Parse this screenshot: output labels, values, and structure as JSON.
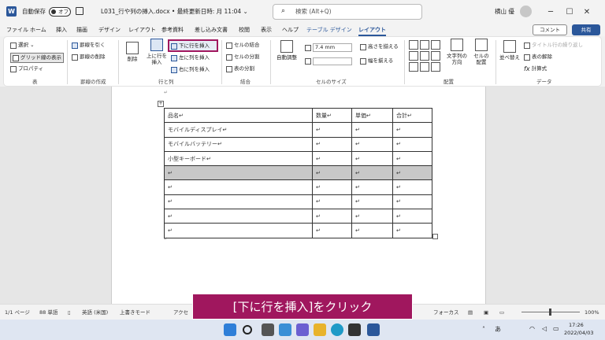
{
  "titlebar": {
    "autosave": "自動保存",
    "toggle": "オフ",
    "doc": "L031_行や列の挿入.docx • 最終更新日時: 月 11:04 ⌄",
    "search": "検索 (Alt+Q)",
    "user": "横山 優",
    "minimize": "─",
    "maximize": "☐",
    "close": "✕"
  },
  "tabs": [
    "ファイル",
    "ホーム",
    "挿入",
    "描画",
    "デザイン",
    "レイアウト",
    "参考資料",
    "差し込み文書",
    "校閲",
    "表示",
    "ヘルプ",
    "テーブル デザイン",
    "レイアウト"
  ],
  "ribbon": {
    "comment": "コメント",
    "share": "共有",
    "select": "選択 ⌄",
    "gridlines": "グリッド線の表示",
    "properties": "プロパティ",
    "group_table": "表",
    "draw": "罫線を引く",
    "erase": "罫線の削除",
    "group_draw": "罫線の作成",
    "delete": "削除",
    "insert_above": "上に行を挿入",
    "insert_below": "下に行を挿入",
    "insert_left": "左に列を挿入",
    "insert_right": "右に列を挿入",
    "group_rows": "行と列",
    "merge": "セルの結合",
    "split": "セルの分割",
    "split_table": "表の分割",
    "group_merge": "結合",
    "autofit": "自動調整",
    "height": "7.4 mm",
    "width": "",
    "dist_rows": "高さを揃える",
    "dist_cols": "幅を揃える",
    "group_size": "セルのサイズ",
    "textdir": "文字列の方向",
    "margins": "セルの配置",
    "group_align": "配置",
    "sort": "並べ替え",
    "header_rows": "タイトル行の繰り返し",
    "convert": "表の解除",
    "formula": "計算式",
    "group_data": "データ"
  },
  "table": {
    "header": [
      "品名↵",
      "数量↵",
      "単価↵",
      "合計↵"
    ],
    "rows": [
      [
        "モバイルディスプレイ↵",
        "↵",
        "↵",
        "↵"
      ],
      [
        "モバイルバッテリー↵",
        "↵",
        "↵",
        "↵"
      ],
      [
        "小型キーボード↵",
        "↵",
        "↵",
        "↵"
      ],
      [
        "↵",
        "↵",
        "↵",
        "↵"
      ],
      [
        "↵",
        "↵",
        "↵",
        "↵"
      ],
      [
        "↵",
        "↵",
        "↵",
        "↵"
      ],
      [
        "↵",
        "↵",
        "↵",
        "↵"
      ],
      [
        "↵",
        "↵",
        "↵",
        "↵"
      ]
    ]
  },
  "para_marks": {
    "top": "↵",
    "after": "↵"
  },
  "caption": "[下に行を挿入]をクリック",
  "status": {
    "page": "1/1 ページ",
    "words": "88 単語",
    "lang": "英語 (米国)",
    "mode": "上書きモード",
    "access": "アクセ",
    "focus": "フォーカス",
    "zoom": "100%"
  },
  "taskbar": {
    "time": "17:26",
    "date": "2022/04/03",
    "ime": "あ"
  },
  "colors": {
    "accent": "#2b579a",
    "caption": "#a0175e"
  }
}
